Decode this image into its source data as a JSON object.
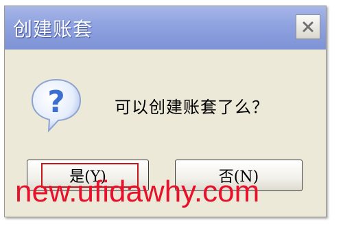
{
  "dialog": {
    "title": "创建账套",
    "close_icon": "close-icon",
    "message": "可以创建账套了么？",
    "icon": "question-icon",
    "buttons": {
      "yes_label": "是(Y)",
      "no_label": "否(N)"
    }
  },
  "watermark": "new.ufidawhy.com",
  "colors": {
    "title_bar": "#8fa2e0",
    "dialog_bg": "#ece9d8",
    "focus_ring": "#c8161d",
    "watermark": "#e8102a",
    "icon_blue": "#3d6fd0"
  }
}
